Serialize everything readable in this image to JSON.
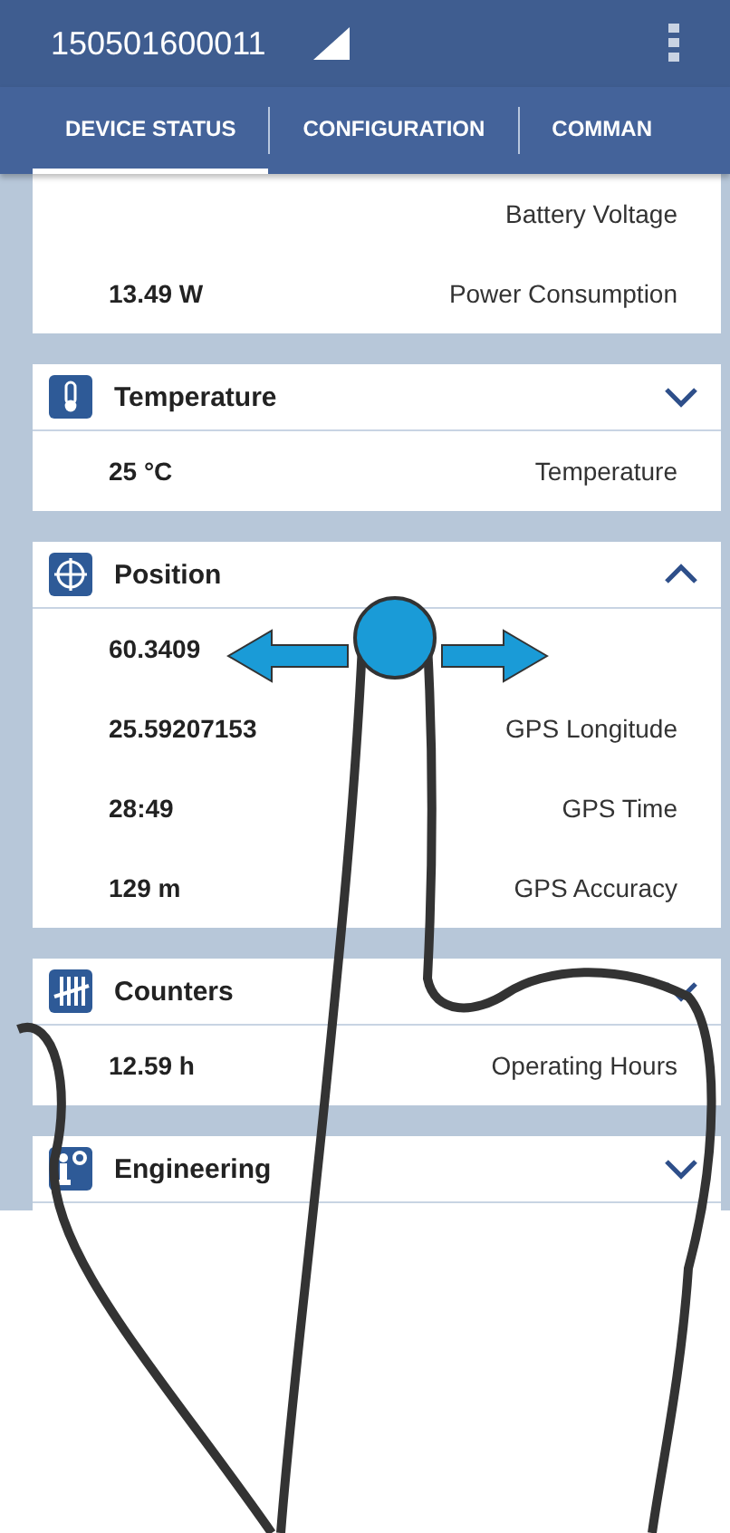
{
  "status_bar": {
    "title": "150501600011"
  },
  "tabs": [
    {
      "label": "DEVICE STATUS",
      "selected": true
    },
    {
      "label": "CONFIGURATION",
      "selected": false
    },
    {
      "label": "COMMAN",
      "selected": false
    }
  ],
  "sections": [
    {
      "kind": "plain",
      "rows": [
        {
          "label": "Battery Voltage"
        },
        {
          "value": "13.49 W",
          "label": "Power Consumption"
        }
      ]
    },
    {
      "kind": "temperature",
      "title": "Temperature",
      "expanded": false,
      "rows": [
        {
          "value": "25 °C",
          "label": "Temperature"
        }
      ]
    },
    {
      "kind": "position",
      "title": "Position",
      "expanded": true,
      "rows": [
        {
          "value": "60.3409"
        },
        {
          "value": "25.59207153",
          "label": "GPS Longitude"
        },
        {
          "value": "28:49",
          "label": "GPS Time"
        },
        {
          "value": "129 m",
          "label": "GPS Accuracy"
        }
      ]
    },
    {
      "kind": "counters",
      "title": "Counters",
      "expanded": false,
      "rows": [
        {
          "value": "12.59 h",
          "label": "Operating Hours"
        }
      ]
    },
    {
      "kind": "engineering",
      "title": "Engineering",
      "expanded": false
    }
  ]
}
